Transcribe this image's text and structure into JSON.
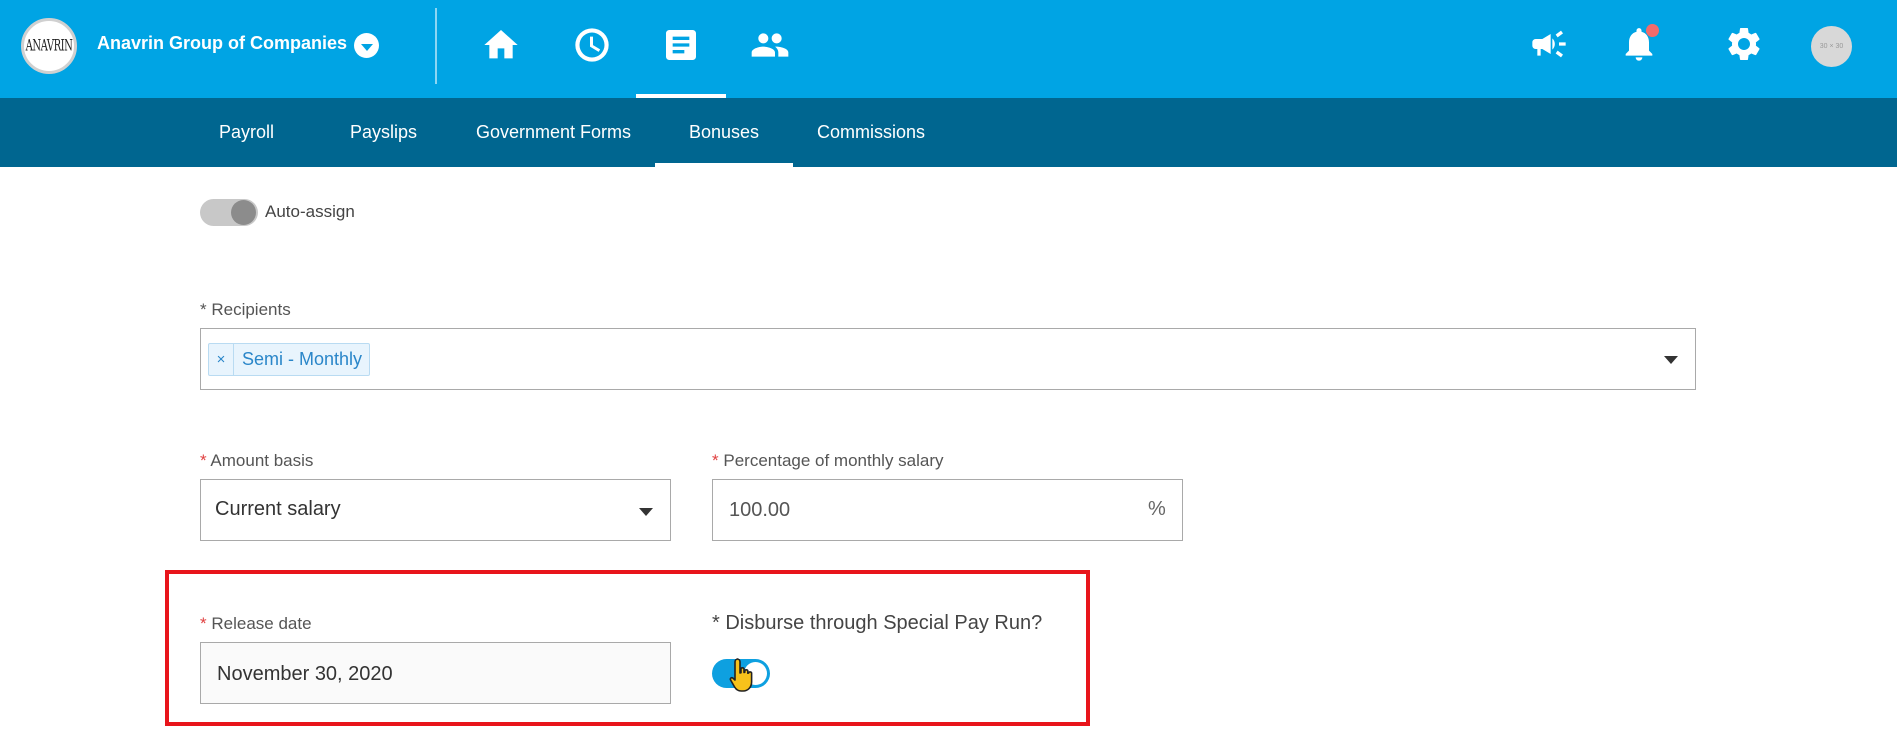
{
  "header": {
    "logo_text": "ANAVRIN",
    "company_name": "Anavrin Group of Companies",
    "nav_icons": [
      "home-icon",
      "clock-icon",
      "document-icon",
      "people-icon"
    ],
    "active_nav": "document-icon",
    "right_icons": [
      "megaphone-icon",
      "bell-icon",
      "gear-icon"
    ],
    "avatar_text": "30 × 30"
  },
  "subnav": {
    "tabs": [
      "Payroll",
      "Payslips",
      "Government Forms",
      "Bonuses",
      "Commissions"
    ],
    "active_tab": "Bonuses"
  },
  "form": {
    "auto_assign_label": "Auto-assign",
    "recipients_label": "* Recipients",
    "recipient_tag": "Semi - Monthly",
    "tag_remove": "×",
    "amount_basis_label": "Amount basis",
    "amount_basis_value": "Current salary",
    "percentage_label": "Percentage of monthly salary",
    "percentage_value": "100.00",
    "percentage_unit": "%",
    "release_date_label": "Release date",
    "release_date_value": "November 30, 2020",
    "disburse_label": "* Disburse through Special Pay Run?",
    "required_mark": "*"
  },
  "colors": {
    "topbar": "#00a4e4",
    "subnav": "#006690",
    "highlight_border": "#e8151b",
    "toggle_on": "#0ea0e0"
  }
}
